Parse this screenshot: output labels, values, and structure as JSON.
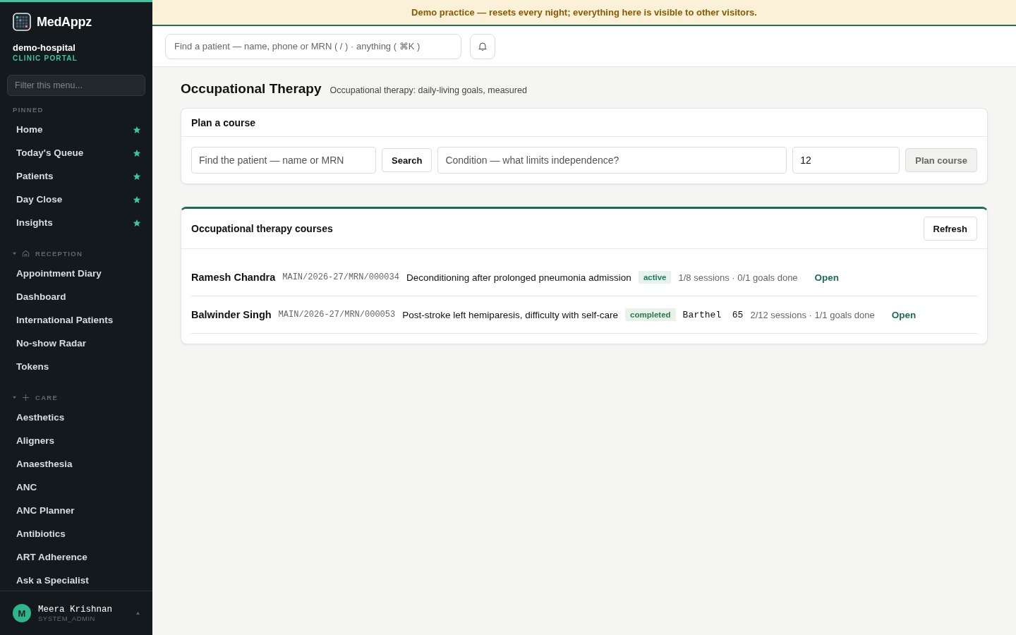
{
  "banner": "Demo practice — resets every night; everything here is visible to other visitors.",
  "brand": {
    "name": "MedAppz",
    "org": "demo-hospital",
    "portal": "CLINIC PORTAL"
  },
  "sidebar": {
    "filter_placeholder": "Filter this menu...",
    "pinned": {
      "title": "PINNED",
      "items": [
        {
          "label": "Home",
          "starred": true
        },
        {
          "label": "Today's Queue",
          "starred": true
        },
        {
          "label": "Patients",
          "starred": true
        },
        {
          "label": "Day Close",
          "starred": true
        },
        {
          "label": "Insights",
          "starred": true
        }
      ]
    },
    "sections": [
      {
        "title": "RECEPTION",
        "kind": "house",
        "expanded": true,
        "items": [
          "Appointment Diary",
          "Dashboard",
          "International Patients",
          "No-show Radar",
          "Tokens"
        ]
      },
      {
        "title": "CARE",
        "kind": "plus",
        "expanded": true,
        "items": [
          "Aesthetics",
          "Aligners",
          "Anaesthesia",
          "ANC",
          "ANC Planner",
          "Antibiotics",
          "ART Adherence",
          "Ask a Specialist"
        ]
      }
    ],
    "user": {
      "initial": "M",
      "name": "Meera Krishnan",
      "role": "SYSTEM_ADMIN"
    }
  },
  "topbar": {
    "search_placeholder": "Find a patient — name, phone or MRN ( / ) · anything ( ⌘K )"
  },
  "page": {
    "title": "Occupational Therapy",
    "subtitle": "Occupational therapy: daily-living goals, measured"
  },
  "plan": {
    "title": "Plan a course",
    "patient_placeholder": "Find the patient — name or MRN",
    "search_button": "Search",
    "condition_placeholder": "Condition — what limits independence?",
    "sessions_value": "12",
    "plan_button": "Plan course",
    "plan_disabled": true
  },
  "courses": {
    "title": "Occupational therapy courses",
    "refresh_button": "Refresh",
    "rows": [
      {
        "name": "Ramesh Chandra",
        "mrn": "MAIN/2026-27/MRN/000034",
        "condition": "Deconditioning after prolonged pneumonia admission",
        "status": "active",
        "score": "",
        "progress": "1/8 sessions · 0/1 goals done",
        "link": "Open"
      },
      {
        "name": "Balwinder Singh",
        "mrn": "MAIN/2026-27/MRN/000053",
        "condition": "Post-stroke left hemiparesis, difficulty with self-care",
        "status": "completed",
        "score": "Barthel  65",
        "progress": "2/12 sessions · 1/1 goals done",
        "link": "Open"
      }
    ]
  }
}
